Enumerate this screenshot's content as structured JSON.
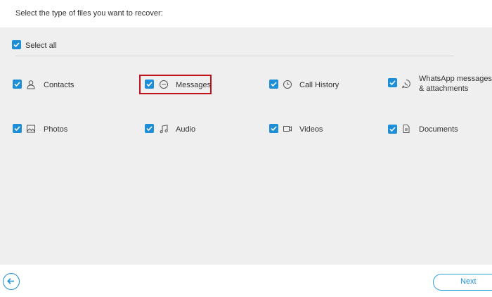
{
  "header": {
    "title": "Select the type of files you want to recover:"
  },
  "select_all": {
    "label": "Select all",
    "checked": true
  },
  "file_types": [
    {
      "label": "Contacts",
      "icon": "person-icon",
      "checked": true
    },
    {
      "label": "Messages",
      "icon": "chat-bubble-icon",
      "checked": true,
      "highlighted": true
    },
    {
      "label": "Call History",
      "icon": "clock-icon",
      "checked": true
    },
    {
      "label_line1": "WhatsApp messages",
      "label_line2": "& attachments",
      "icon": "whatsapp-icon",
      "checked": true
    },
    {
      "label": "Photos",
      "icon": "image-icon",
      "checked": true
    },
    {
      "label": "Audio",
      "icon": "music-note-icon",
      "checked": true
    },
    {
      "label": "Videos",
      "icon": "video-camera-icon",
      "checked": true
    },
    {
      "label": "Documents",
      "icon": "document-icon",
      "checked": true
    }
  ],
  "footer": {
    "next_label": "Next",
    "back_icon": "arrow-left-icon"
  },
  "colors": {
    "accent": "#1e8fd6",
    "highlight": "#c0121a",
    "panel": "#efefef"
  }
}
